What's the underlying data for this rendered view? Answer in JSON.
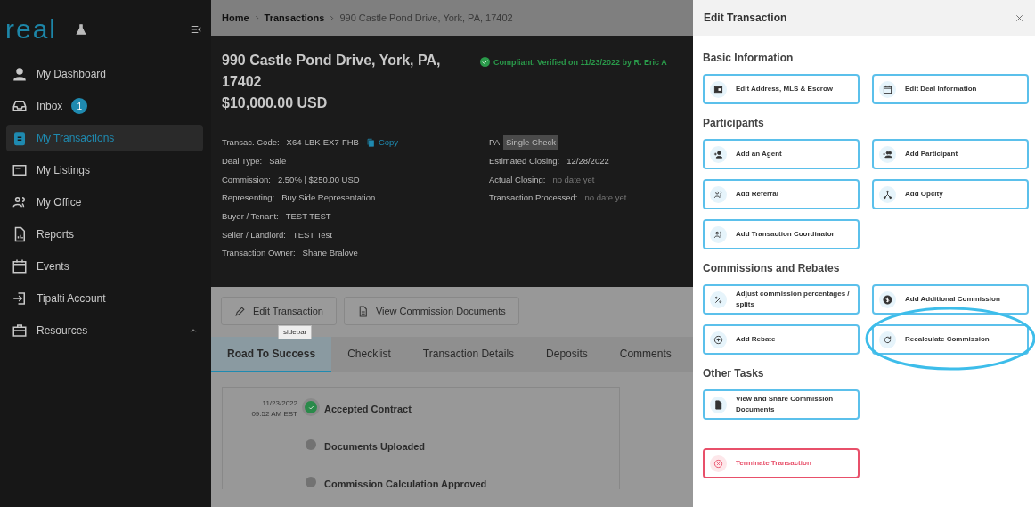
{
  "sidebar": {
    "logo": "real",
    "items": [
      {
        "label": "My Dashboard",
        "selected": false
      },
      {
        "label": "Inbox",
        "badge": "1",
        "selected": false
      },
      {
        "label": "My Transactions",
        "selected": true
      },
      {
        "label": "My Listings",
        "selected": false
      },
      {
        "label": "My Office",
        "selected": false
      },
      {
        "label": "Reports",
        "selected": false
      },
      {
        "label": "Events",
        "selected": false
      },
      {
        "label": "Tipalti Account",
        "selected": false
      },
      {
        "label": "Resources",
        "expanded": true,
        "selected": false
      }
    ]
  },
  "breadcrumb": [
    {
      "label": "Home",
      "current": false
    },
    {
      "label": "Transactions",
      "current": false
    },
    {
      "label": "990 Castle Pond Drive, York, PA, 17402",
      "current": true
    }
  ],
  "header": {
    "address": "990 Castle Pond Drive, York, PA, 17402",
    "price": "$10,000.00 USD",
    "compliance": "Compliant. Verified on 11/23/2022 by R. Eric A",
    "left_fields": [
      {
        "label": "Transac. Code:",
        "value": "X64-LBK-EX7-FHB",
        "copy": "Copy"
      },
      {
        "label": "Deal Type:",
        "value": "Sale"
      },
      {
        "label": "Commission:",
        "value": "2.50% | $250.00 USD"
      },
      {
        "label": "Representing:",
        "value": "Buy Side Representation"
      },
      {
        "label": "Buyer / Tenant:",
        "value": "TEST TEST"
      },
      {
        "label": "Seller / Landlord:",
        "value": "TEST Test"
      },
      {
        "label": "Transaction Owner:",
        "value": "Shane Bralove"
      }
    ],
    "state": "PA",
    "check_tag": "Single Check",
    "right_fields": [
      {
        "label": "Estimated Closing:",
        "value": "12/28/2022",
        "muted": false
      },
      {
        "label": "Actual Closing:",
        "value": "no date yet",
        "muted": true
      },
      {
        "label": "Transaction Processed:",
        "value": "no date yet",
        "muted": true
      }
    ]
  },
  "actions": [
    {
      "label": "Edit Transaction"
    },
    {
      "label": "View Commission Documents"
    }
  ],
  "tooltip": "sidebar",
  "tabs": [
    {
      "label": "Road To Success",
      "selected": true
    },
    {
      "label": "Checklist",
      "selected": false
    },
    {
      "label": "Transaction Details",
      "selected": false
    },
    {
      "label": "Deposits",
      "selected": false
    },
    {
      "label": "Comments",
      "selected": false
    }
  ],
  "timeline": [
    {
      "title": "Accepted Contract",
      "date": "11/23/2022",
      "time": "09:52 AM EST",
      "done": true
    },
    {
      "title": "Documents Uploaded",
      "done": false
    },
    {
      "title": "Commission Calculation Approved",
      "done": false
    }
  ],
  "drawer": {
    "title": "Edit Transaction",
    "sections": [
      {
        "title": "Basic Information",
        "buttons": [
          {
            "label": "Edit Address, MLS & Escrow"
          },
          {
            "label": "Edit Deal Information"
          }
        ]
      },
      {
        "title": "Participants",
        "buttons": [
          {
            "label": "Add an Agent"
          },
          {
            "label": "Add Participant"
          },
          {
            "label": "Add Referral"
          },
          {
            "label": "Add Opcity"
          },
          {
            "label": "Add Transaction Coordinator"
          }
        ]
      },
      {
        "title": "Commissions and Rebates",
        "buttons": [
          {
            "label": "Adjust commission percentages / splits"
          },
          {
            "label": "Add Additional Commission"
          },
          {
            "label": "Add Rebate"
          },
          {
            "label": "Recalculate Commission",
            "annotated": true
          }
        ]
      },
      {
        "title": "Other Tasks",
        "buttons": [
          {
            "label": "View and Share Commission Documents"
          }
        ]
      }
    ],
    "danger_button": {
      "label": "Terminate Transaction"
    }
  }
}
